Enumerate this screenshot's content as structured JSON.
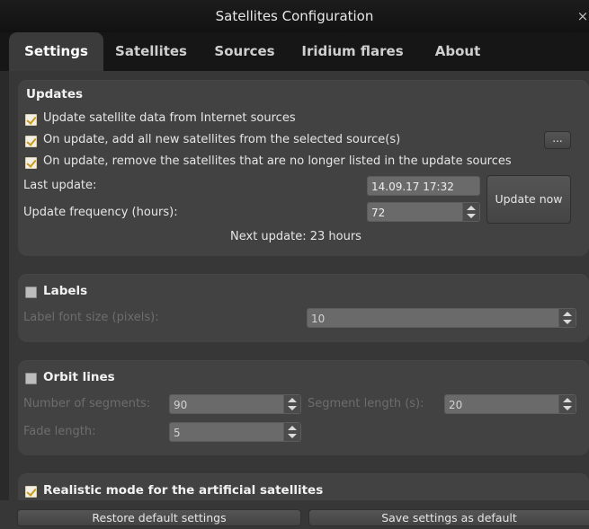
{
  "window": {
    "title": "Satellites Configuration",
    "close_glyph": "×"
  },
  "tabs": [
    {
      "label": "Settings",
      "active": true
    },
    {
      "label": "Satellites"
    },
    {
      "label": "Sources"
    },
    {
      "label": "Iridium flares"
    },
    {
      "label": "About"
    }
  ],
  "updates": {
    "heading": "Updates",
    "options": [
      {
        "label": "Update satellite data from Internet sources",
        "checked": true
      },
      {
        "label": "On update, add all new satellites from the selected source(s)",
        "checked": true
      },
      {
        "label": "On update, remove the satellites that are no longer listed in the update sources",
        "checked": true
      }
    ],
    "more_button_label": "...",
    "last_update_label": "Last update:",
    "last_update_value": "14.09.17 17:32",
    "frequency_label": "Update frequency (hours):",
    "frequency_value": "72",
    "update_now_label": "Update now",
    "next_update_text": "Next update: 23 hours"
  },
  "labels_group": {
    "heading": "Labels",
    "checked": false,
    "font_size_label": "Label font size (pixels):",
    "font_size_value": "10"
  },
  "orbit_group": {
    "heading": "Orbit lines",
    "checked": false,
    "segments_label": "Number of  segments:",
    "segments_value": "90",
    "segment_length_label": "Segment length (s):",
    "segment_length_value": "20",
    "fade_length_label": "Fade length:",
    "fade_length_value": "5"
  },
  "realistic": {
    "label": "Realistic mode for the artificial satellites",
    "checked": true
  },
  "footer": {
    "restore_label": "Restore default settings",
    "save_label": "Save settings as default"
  },
  "colors": {
    "accent_check": "#c79a1f",
    "background": "#2a2a2a",
    "group": "#424242"
  }
}
